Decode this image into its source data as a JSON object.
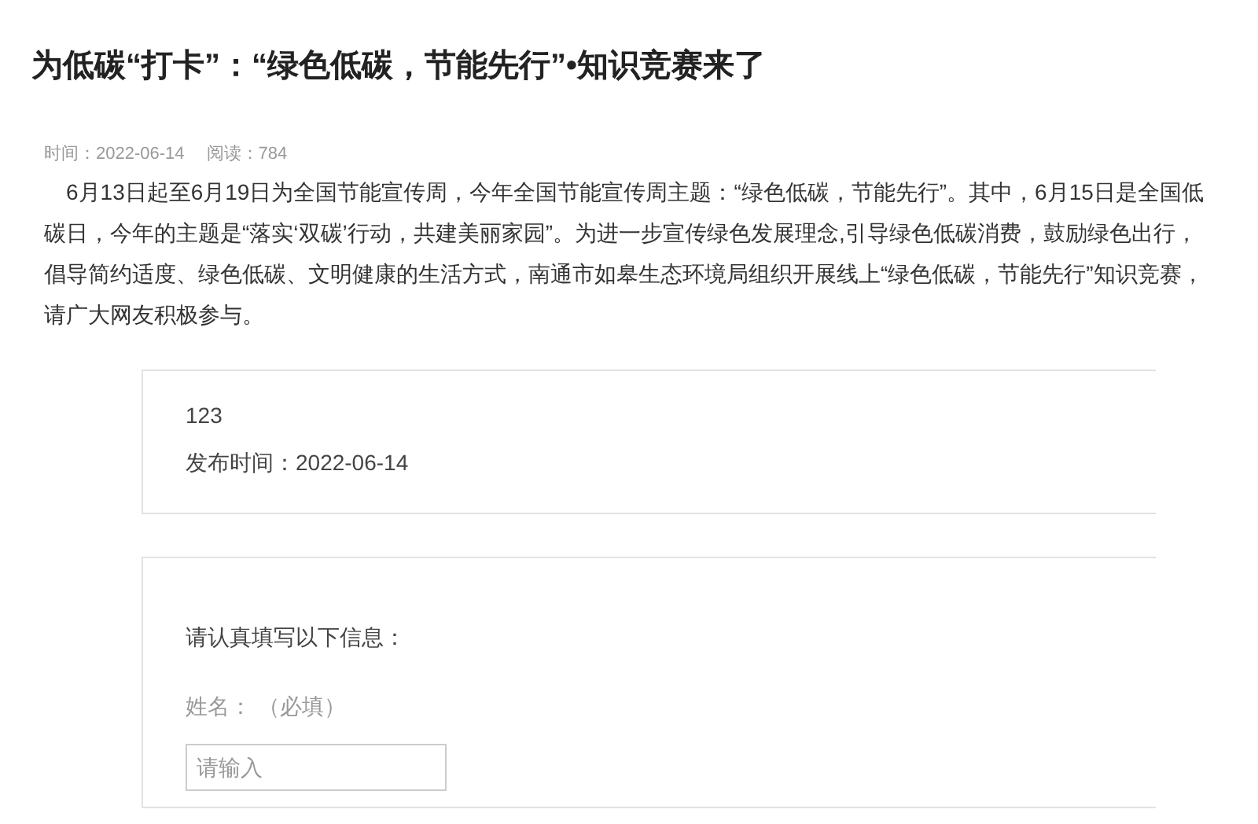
{
  "article": {
    "title": "为低碳“打卡”：“绿色低碳，节能先行”•知识竞赛来了",
    "meta": [
      {
        "label": "时间：",
        "value": "2022-06-14"
      },
      {
        "label": "阅读：",
        "value": "784"
      }
    ],
    "body": "6月13日起至6月19日为全国节能宣传周，今年全国节能宣传周主题：“绿色低碳，节能先行”。其中，6月15日是全国低碳日，今年的主题是“落实‘双碳’行动，共建美丽家园”。为进一步宣传绿色发展理念,引导绿色低碳消费，鼓励绿色出行，倡导简约适度、绿色低碳、文明健康的生活方式，南通市如皋生态环境局组织开展线上“绿色低碳，节能先行”知识竞赛，请广大网友积极参与。"
  },
  "info_card": {
    "name": "123",
    "published": "发布时间：2022-06-14"
  },
  "form": {
    "intro": "请认真填写以下信息：",
    "fields": [
      {
        "label": "姓名：",
        "hint": "（必填）",
        "placeholder": "请输入"
      }
    ]
  }
}
